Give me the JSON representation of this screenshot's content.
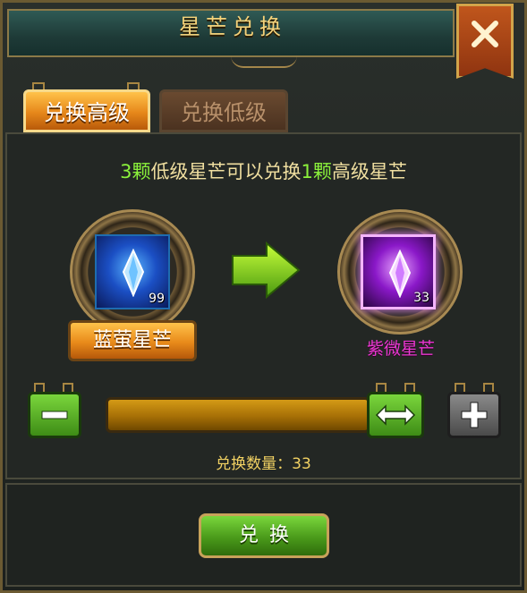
{
  "dialog": {
    "title": "星芒兑换",
    "close_icon": "close-x-icon"
  },
  "tabs": [
    {
      "label": "兑换高级",
      "active": true
    },
    {
      "label": "兑换低级",
      "active": false
    }
  ],
  "hint": {
    "count_a": "3颗",
    "text_a": "低级星芒可以兑换",
    "count_b": "1颗",
    "text_b": "高级星芒"
  },
  "source_item": {
    "name": "蓝萤星芒",
    "count": "99",
    "icon": "blue-crystal-icon",
    "color": "#1b4fc4"
  },
  "target_item": {
    "name": "紫微星芒",
    "count": "33",
    "icon": "purple-crystal-icon",
    "color": "#8a18c8"
  },
  "quantity": {
    "label": "兑换数量：",
    "value": "33",
    "fill_fraction": 1.0
  },
  "exchange_button": {
    "label": "兑换"
  },
  "colors": {
    "accent_gold": "#f4d27a",
    "number_green": "#8bf23b",
    "purple_name": "#e838d0"
  }
}
